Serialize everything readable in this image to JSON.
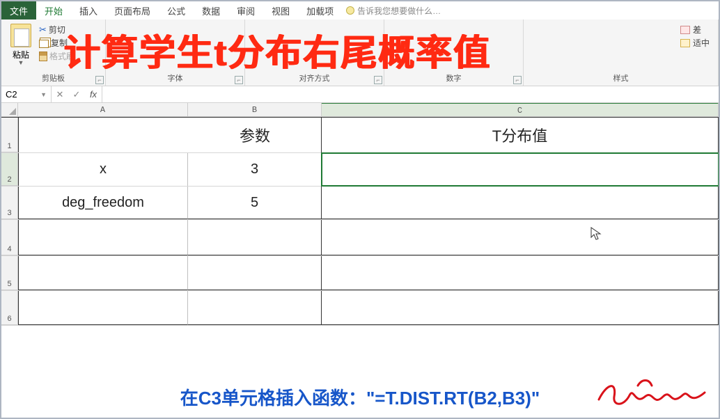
{
  "tabs": {
    "file": "文件",
    "home": "开始",
    "insert": "插入",
    "page_layout": "页面布局",
    "formulas": "公式",
    "data": "数据",
    "review": "审阅",
    "view": "视图",
    "addins": "加载项",
    "tell_me": "告诉我您想要做什么…"
  },
  "clipboard": {
    "paste": "粘贴",
    "cut": "剪切",
    "copy": "复制",
    "format_painter": "格式刷",
    "group_label": "剪贴板"
  },
  "ribbon_groups": {
    "font": "字体",
    "alignment": "对齐方式",
    "number": "数字",
    "styles": "样式"
  },
  "styles": {
    "bad": "差",
    "neutral": "适中"
  },
  "overlay_title": "计算学生t分布右尾概率值",
  "name_box": "C2",
  "fx_btns": {
    "cancel": "✕",
    "enter": "✓",
    "fx": "fx"
  },
  "col_heads": {
    "A": "A",
    "B": "B",
    "C": "C"
  },
  "row_heads": {
    "r1": "1",
    "r2": "2",
    "r3": "3",
    "r4": "4",
    "r5": "5",
    "r6": "6"
  },
  "sheet": {
    "A1B1": "参数",
    "C1": "T分布值",
    "A2": "x",
    "B2": "3",
    "A3": "deg_freedom",
    "B3": "5"
  },
  "caption": "在C3单元格插入函数：\"=T.DIST.RT(B2,B3)\""
}
